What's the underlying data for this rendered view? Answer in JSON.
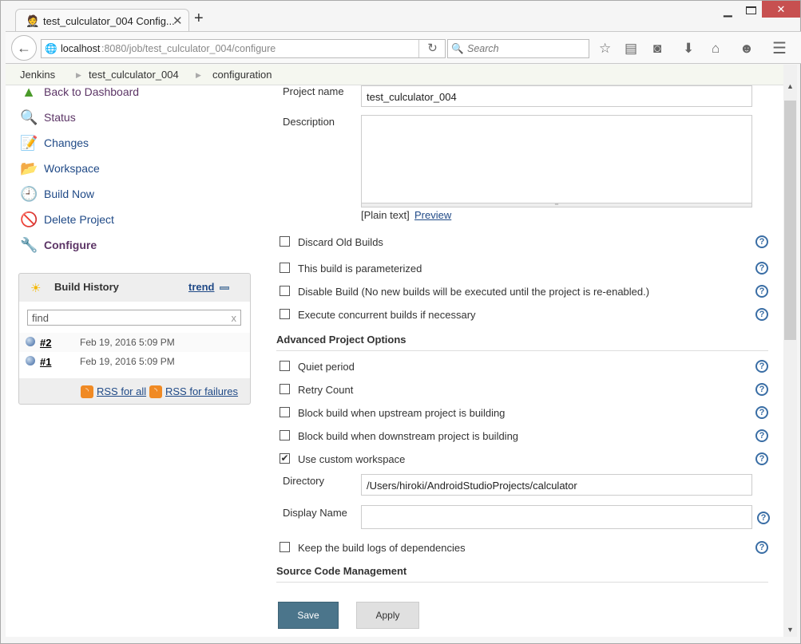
{
  "browser": {
    "tab_title": "test_culculator_004 Config...",
    "url_host": "localhost",
    "url_rest": ":8080/job/test_culculator_004/configure",
    "search_placeholder": "Search"
  },
  "breadcrumb": [
    "Jenkins",
    "test_culculator_004",
    "configuration"
  ],
  "sidebar": {
    "items": [
      {
        "label": "Back to Dashboard",
        "icon": "up-arrow-icon"
      },
      {
        "label": "Status",
        "icon": "magnifier-icon"
      },
      {
        "label": "Changes",
        "icon": "notepad-icon"
      },
      {
        "label": "Workspace",
        "icon": "folder-icon"
      },
      {
        "label": "Build Now",
        "icon": "clock-play-icon"
      },
      {
        "label": "Delete Project",
        "icon": "no-entry-icon"
      },
      {
        "label": "Configure",
        "icon": "tools-icon"
      }
    ]
  },
  "build_history": {
    "title": "Build History",
    "trend": "trend",
    "find_placeholder": "find",
    "clear": "x",
    "builds": [
      {
        "id": "#2",
        "date": "Feb 19, 2016 5:09 PM"
      },
      {
        "id": "#1",
        "date": "Feb 19, 2016 5:09 PM"
      }
    ],
    "rss_all": "RSS for all",
    "rss_failures": "RSS for failures"
  },
  "form": {
    "project_name_label": "Project name",
    "project_name": "test_culculator_004",
    "description_label": "Description",
    "description": "",
    "plain_text": "[Plain text]",
    "preview": "Preview",
    "options": [
      {
        "label": "Discard Old Builds",
        "checked": false
      },
      {
        "label": "This build is parameterized",
        "checked": false
      },
      {
        "label": "Disable Build (No new builds will be executed until the project is re-enabled.)",
        "checked": false
      },
      {
        "label": "Execute concurrent builds if necessary",
        "checked": false
      }
    ],
    "advanced_title": "Advanced Project Options",
    "advanced": [
      {
        "label": "Quiet period",
        "checked": false
      },
      {
        "label": "Retry Count",
        "checked": false
      },
      {
        "label": "Block build when upstream project is building",
        "checked": false
      },
      {
        "label": "Block build when downstream project is building",
        "checked": false
      },
      {
        "label": "Use custom workspace",
        "checked": true
      }
    ],
    "directory_label": "Directory",
    "directory": "/Users/hiroki/AndroidStudioProjects/calculator",
    "display_name_label": "Display Name",
    "display_name": "",
    "keep_logs": {
      "label": "Keep the build logs of dependencies",
      "checked": false
    },
    "scm_title": "Source Code Management",
    "save": "Save",
    "apply": "Apply"
  },
  "colors": {
    "save_button": "#4b758b",
    "link": "#204a87",
    "visited": "#5c3566",
    "close": "#c75050"
  }
}
